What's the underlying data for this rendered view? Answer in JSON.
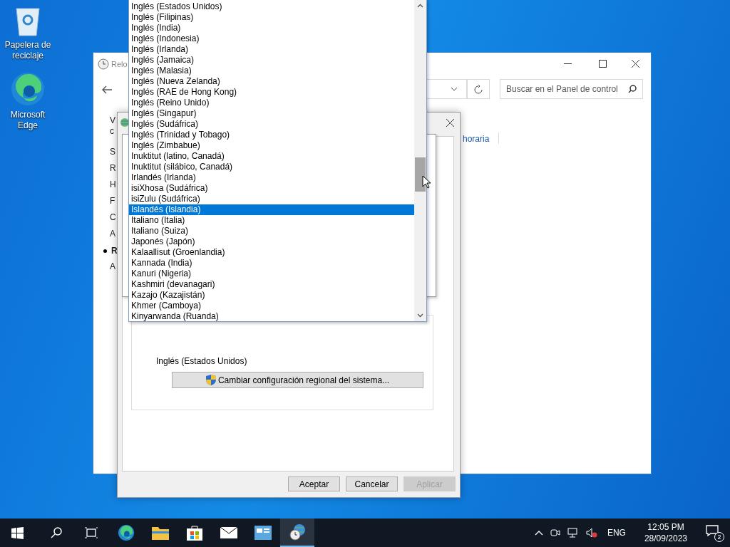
{
  "desktop_icons": [
    {
      "kind": "recycle",
      "label": "Papelera de reciclaje"
    },
    {
      "kind": "edge",
      "label": "Microsoft Edge"
    }
  ],
  "control_panel": {
    "title": "Relo",
    "search": {
      "placeholder": "Buscar en el Panel de control"
    },
    "link": "horaria",
    "sidebar_fragments": [
      {
        "text": "V",
        "selected": false
      },
      {
        "text": "c",
        "selected": false
      },
      {
        "text": "S",
        "selected": false
      },
      {
        "text": "R",
        "selected": false
      },
      {
        "text": "H",
        "selected": false
      },
      {
        "text": "F",
        "selected": false
      },
      {
        "text": "C",
        "selected": false
      },
      {
        "text": "A",
        "selected": false
      },
      {
        "text": "R",
        "selected": true
      },
      {
        "text": "A",
        "selected": false
      }
    ]
  },
  "region_dialog": {
    "system_locale": "Inglés (Estados Unidos)",
    "change_button": "Cambiar configuración regional del sistema...",
    "buttons": [
      {
        "label": "Aceptar",
        "disabled": false
      },
      {
        "label": "Cancelar",
        "disabled": false
      },
      {
        "label": "Aplicar",
        "disabled": true
      }
    ]
  },
  "dropdown": {
    "items": [
      {
        "label": "Inglés (Estados Unidos)",
        "selected": false
      },
      {
        "label": "Inglés (Filipinas)",
        "selected": false
      },
      {
        "label": "Inglés (India)",
        "selected": false
      },
      {
        "label": "Inglés (Indonesia)",
        "selected": false
      },
      {
        "label": "Inglés (Irlanda)",
        "selected": false
      },
      {
        "label": "Inglés (Jamaica)",
        "selected": false
      },
      {
        "label": "Inglés (Malasia)",
        "selected": false
      },
      {
        "label": "Inglés (Nueva Zelanda)",
        "selected": false
      },
      {
        "label": "Inglés (RAE de Hong Kong)",
        "selected": false
      },
      {
        "label": "Inglés (Reino Unido)",
        "selected": false
      },
      {
        "label": "Inglés (Singapur)",
        "selected": false
      },
      {
        "label": "Inglés (Sudáfrica)",
        "selected": false
      },
      {
        "label": "Inglés (Trinidad y Tobago)",
        "selected": false
      },
      {
        "label": "Inglés (Zimbabue)",
        "selected": false
      },
      {
        "label": "Inuktitut (latino, Canadá)",
        "selected": false
      },
      {
        "label": "Inuktitut (silábico, Canadá)",
        "selected": false
      },
      {
        "label": "Irlandés (Irlanda)",
        "selected": false
      },
      {
        "label": "isiXhosa (Sudáfrica)",
        "selected": false
      },
      {
        "label": "isiZulu (Sudáfrica)",
        "selected": false
      },
      {
        "label": "Islandés (Islandia)",
        "selected": true
      },
      {
        "label": "Italiano (Italia)",
        "selected": false
      },
      {
        "label": "Italiano (Suiza)",
        "selected": false
      },
      {
        "label": "Japonés (Japón)",
        "selected": false
      },
      {
        "label": "Kalaallisut (Groenlandia)",
        "selected": false
      },
      {
        "label": "Kannada (India)",
        "selected": false
      },
      {
        "label": "Kanuri (Nigeria)",
        "selected": false
      },
      {
        "label": "Kashmiri (devanagari)",
        "selected": false
      },
      {
        "label": "Kazajo (Kazajistán)",
        "selected": false
      },
      {
        "label": "Khmer (Camboya)",
        "selected": false
      },
      {
        "label": "Kinyarwanda (Ruanda)",
        "selected": false
      }
    ]
  },
  "taskbar": {
    "apps": [
      {
        "kind": "edge",
        "active": false
      },
      {
        "kind": "folder",
        "active": false
      },
      {
        "kind": "store",
        "active": false
      },
      {
        "kind": "mail",
        "active": false
      },
      {
        "kind": "panel",
        "active": false
      },
      {
        "kind": "globe",
        "active": true
      }
    ],
    "language": "ENG",
    "time": "12:05 PM",
    "date": "28/09/2023",
    "notification_count": "2"
  }
}
